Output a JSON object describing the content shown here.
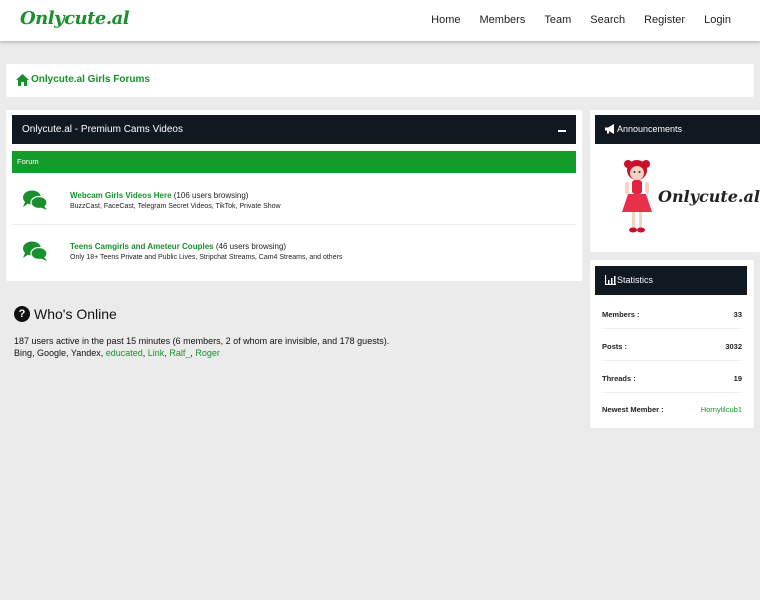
{
  "header": {
    "logo": "Onlycute.al",
    "nav": [
      "Home",
      "Members",
      "Team",
      "Search",
      "Register",
      "Login"
    ]
  },
  "breadcrumb": {
    "title": "Onlycute.al Girls Forums"
  },
  "category": {
    "title": "Onlycute.al - Premium Cams Videos",
    "column_header": "Forum",
    "forums": [
      {
        "name": "Webcam Girls Videos Here",
        "browsing": "(106 users browsing)",
        "description": "BuzzCast, FaceCast, Telegram Secret Videos, TikTok, Private Show"
      },
      {
        "name": "Teens Camgirls and Ameteur Couples",
        "browsing": "(46 users browsing)",
        "description": "Only 18+ Teens Private and Public Lives, Stripchat Streams, Cam4 Streams, and others"
      }
    ]
  },
  "whos_online": {
    "title": "Who's Online",
    "summary": "187 users active in the past 15 minutes (6 members, 2 of whom are invisible, and 178 guests).",
    "bots": "Bing, Google, Yandex, ",
    "members": [
      "educated",
      "Link",
      "Ralf_",
      "Roger"
    ]
  },
  "announcements": {
    "title": "Announcements",
    "logo_text": "Onlycute.al"
  },
  "statistics": {
    "title": "Statistics",
    "rows": [
      {
        "label": "Members :",
        "value": "33"
      },
      {
        "label": "Posts :",
        "value": "3032"
      },
      {
        "label": "Threads :",
        "value": "19"
      },
      {
        "label": "Newest Member :",
        "value": "Hornylilcub1"
      }
    ]
  },
  "colors": {
    "brand_green": "#1a8f2e",
    "header_dark": "#101820",
    "forum_bar": "#149c2b",
    "background": "#ebebeb"
  },
  "icons": [
    "home-icon",
    "chat-bubbles-icon",
    "question-icon",
    "megaphone-icon",
    "chart-icon"
  ]
}
